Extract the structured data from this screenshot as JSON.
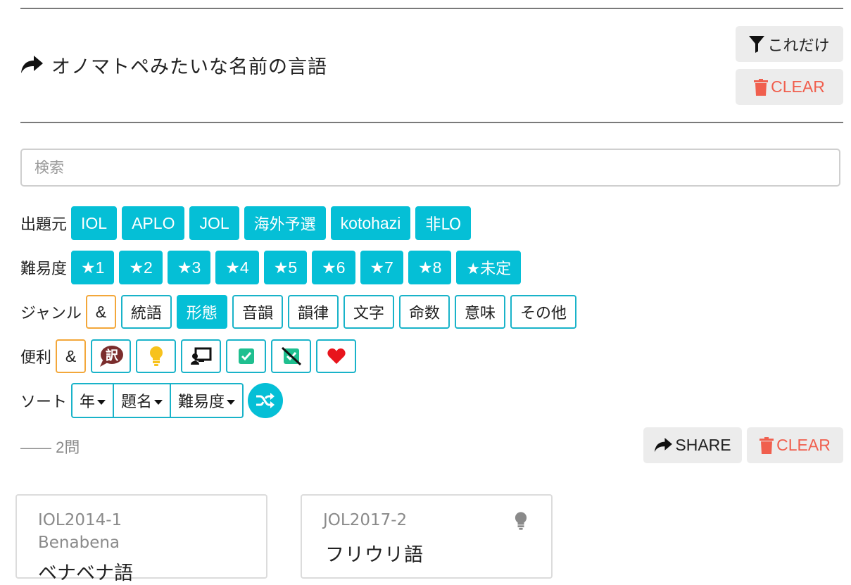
{
  "header": {
    "title": "オノマトペみたいな名前の言語",
    "only_this_label": "これだけ",
    "clear_label": "CLEAR"
  },
  "search": {
    "placeholder": "検索",
    "value": ""
  },
  "filters": {
    "source": {
      "label": "出題元",
      "chips": [
        "IOL",
        "APLO",
        "JOL",
        "海外予選",
        "kotohazi",
        "非LO"
      ]
    },
    "difficulty": {
      "label": "難易度",
      "chips": [
        "★1",
        "★2",
        "★3",
        "★4",
        "★5",
        "★6",
        "★7",
        "★8",
        "★未定"
      ]
    },
    "genre": {
      "label": "ジャンル",
      "and_label": "&",
      "chips": [
        "統語",
        "形態",
        "音韻",
        "韻律",
        "文字",
        "命数",
        "意味",
        "その他"
      ],
      "selected": "形態"
    },
    "convenience": {
      "label": "便利",
      "and_label": "&",
      "icons": [
        "translation-icon",
        "lightbulb-icon",
        "presentation-icon",
        "check-square-icon",
        "check-square-slash-icon",
        "heart-icon"
      ]
    },
    "sort": {
      "label": "ソート",
      "options": [
        "年",
        "題名",
        "難易度"
      ]
    }
  },
  "results": {
    "count_text": "—— 2問",
    "share_label": "SHARE",
    "clear_label": "CLEAR"
  },
  "cards": [
    {
      "id": "IOL2014-1",
      "subtitle": "Benabena",
      "title": "ベナベナ語"
    },
    {
      "id": "JOL2017-2",
      "title": "フリウリ語",
      "has_hint": true
    }
  ],
  "colors": {
    "accent": "#05bfd6",
    "danger": "#f05f4e",
    "and_border": "#f3a73a"
  }
}
